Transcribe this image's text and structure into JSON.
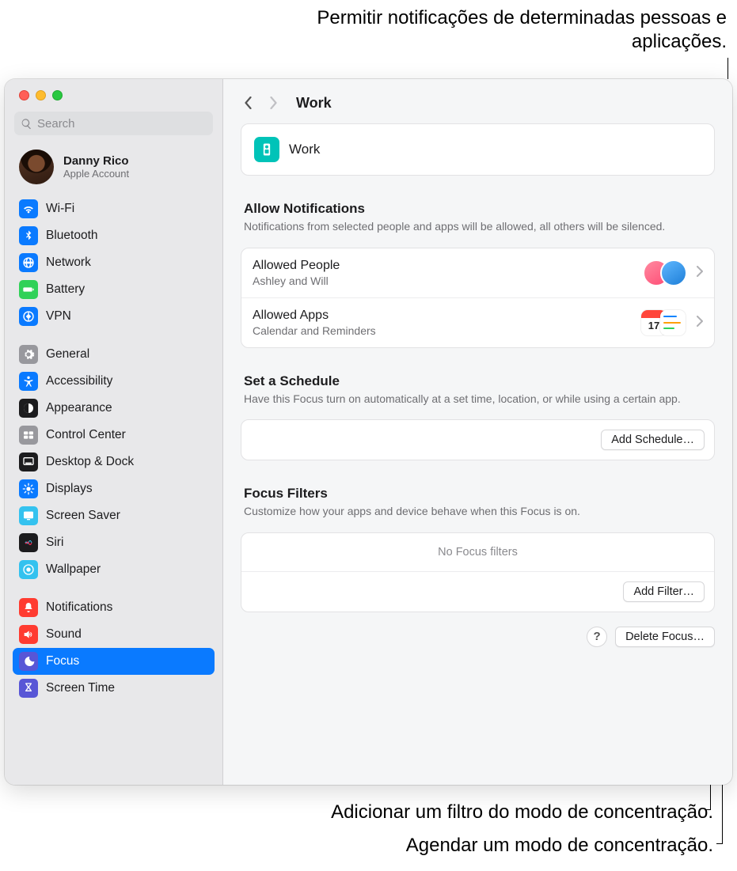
{
  "callouts": {
    "top": "Permitir notificações de determinadas pessoas e aplicações.",
    "addFilter": "Adicionar um filtro do modo de concentração.",
    "addSchedule": "Agendar um modo de concentração."
  },
  "search": {
    "placeholder": "Search"
  },
  "account": {
    "name": "Danny Rico",
    "sub": "Apple Account"
  },
  "sidebar": {
    "g1": [
      {
        "label": "Wi-Fi",
        "bg": "#0a7aff",
        "icon": "wifi"
      },
      {
        "label": "Bluetooth",
        "bg": "#0a7aff",
        "icon": "bt"
      },
      {
        "label": "Network",
        "bg": "#0a7aff",
        "icon": "globe"
      },
      {
        "label": "Battery",
        "bg": "#30d158",
        "icon": "battery"
      },
      {
        "label": "VPN",
        "bg": "#0a7aff",
        "icon": "vpn"
      }
    ],
    "g2": [
      {
        "label": "General",
        "bg": "#98989d",
        "icon": "gear"
      },
      {
        "label": "Accessibility",
        "bg": "#0a7aff",
        "icon": "acc"
      },
      {
        "label": "Appearance",
        "bg": "#1c1c1e",
        "icon": "appear"
      },
      {
        "label": "Control Center",
        "bg": "#98989d",
        "icon": "cc"
      },
      {
        "label": "Desktop & Dock",
        "bg": "#1c1c1e",
        "icon": "dock"
      },
      {
        "label": "Displays",
        "bg": "#0a7aff",
        "icon": "disp"
      },
      {
        "label": "Screen Saver",
        "bg": "#34c2ef",
        "icon": "ss"
      },
      {
        "label": "Siri",
        "bg": "#1c1c1e",
        "icon": "siri"
      },
      {
        "label": "Wallpaper",
        "bg": "#34c2ef",
        "icon": "wall"
      }
    ],
    "g3": [
      {
        "label": "Notifications",
        "bg": "#ff3b30",
        "icon": "bell"
      },
      {
        "label": "Sound",
        "bg": "#ff3b30",
        "icon": "sound"
      },
      {
        "label": "Focus",
        "bg": "#5856d6",
        "icon": "moon",
        "sel": true
      },
      {
        "label": "Screen Time",
        "bg": "#5856d6",
        "icon": "hour"
      }
    ]
  },
  "breadcrumb": {
    "title": "Work"
  },
  "focus": {
    "name": "Work"
  },
  "allow": {
    "heading": "Allow Notifications",
    "desc": "Notifications from selected people and apps will be allowed, all others will be silenced.",
    "people": {
      "title": "Allowed People",
      "sub": "Ashley and Will"
    },
    "apps": {
      "title": "Allowed Apps",
      "sub": "Calendar and Reminders"
    }
  },
  "schedule": {
    "heading": "Set a Schedule",
    "desc": "Have this Focus turn on automatically at a set time, location, or while using a certain app.",
    "button": "Add Schedule…"
  },
  "filters": {
    "heading": "Focus Filters",
    "desc": "Customize how your apps and device behave when this Focus is on.",
    "empty": "No Focus filters",
    "button": "Add Filter…"
  },
  "footer": {
    "help": "?",
    "delete": "Delete Focus…"
  }
}
